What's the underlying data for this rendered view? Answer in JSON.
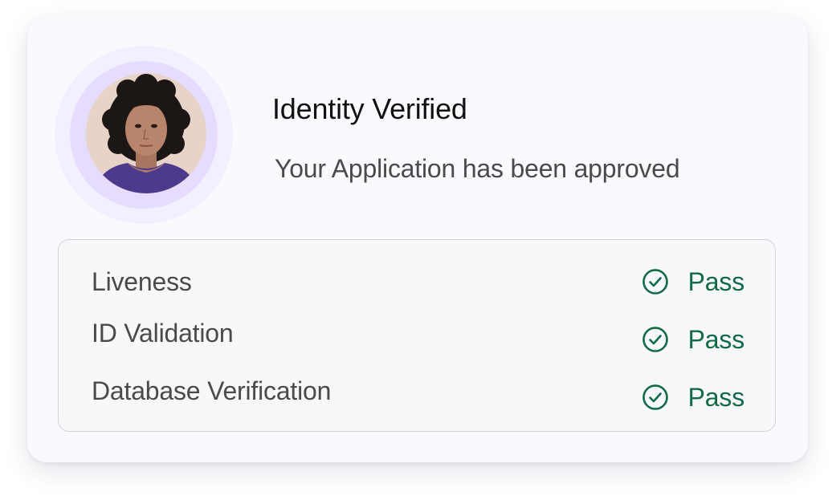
{
  "header": {
    "title": "Identity Verified",
    "subtitle": "Your Application has been approved"
  },
  "avatar": {
    "icon": "user-photo",
    "ring_color_outer": "#f2efff",
    "ring_color_inner": "#e5dcff"
  },
  "checks": [
    {
      "label": "Liveness",
      "status": "Pass",
      "icon": "check-circle-icon"
    },
    {
      "label": "ID Validation",
      "status": "Pass",
      "icon": "check-circle-icon"
    },
    {
      "label": "Database Verification",
      "status": "Pass",
      "icon": "check-circle-icon"
    }
  ],
  "colors": {
    "pass": "#0e6b44",
    "card_background": "#faf9fd",
    "accent": "#e5dcff"
  }
}
